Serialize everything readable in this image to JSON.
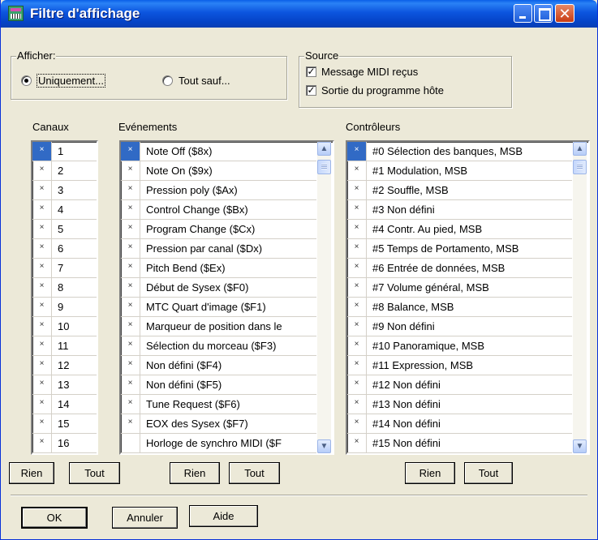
{
  "window": {
    "title": "Filtre d'affichage"
  },
  "afficher": {
    "label": "Afficher:",
    "options": [
      {
        "label": "Uniquement...",
        "checked": true
      },
      {
        "label": "Tout sauf...",
        "checked": false
      }
    ]
  },
  "source": {
    "label": "Source",
    "items": [
      {
        "label": "Message MIDI reçus",
        "checked": true
      },
      {
        "label": "Sortie du programme hôte",
        "checked": true
      }
    ]
  },
  "canaux": {
    "label": "Canaux",
    "rows": [
      {
        "mark": "×",
        "value": "1"
      },
      {
        "mark": "×",
        "value": "2"
      },
      {
        "mark": "×",
        "value": "3"
      },
      {
        "mark": "×",
        "value": "4"
      },
      {
        "mark": "×",
        "value": "5"
      },
      {
        "mark": "×",
        "value": "6"
      },
      {
        "mark": "×",
        "value": "7"
      },
      {
        "mark": "×",
        "value": "8"
      },
      {
        "mark": "×",
        "value": "9"
      },
      {
        "mark": "×",
        "value": "10"
      },
      {
        "mark": "×",
        "value": "11"
      },
      {
        "mark": "×",
        "value": "12"
      },
      {
        "mark": "×",
        "value": "13"
      },
      {
        "mark": "×",
        "value": "14"
      },
      {
        "mark": "×",
        "value": "15"
      },
      {
        "mark": "×",
        "value": "16"
      }
    ],
    "buttons": {
      "none": "Rien",
      "all": "Tout"
    }
  },
  "evenements": {
    "label": "Evénements",
    "rows": [
      {
        "mark": "×",
        "value": "Note Off ($8x)"
      },
      {
        "mark": "×",
        "value": "Note On ($9x)"
      },
      {
        "mark": "×",
        "value": "Pression poly ($Ax)"
      },
      {
        "mark": "×",
        "value": "Control Change ($Bx)"
      },
      {
        "mark": "×",
        "value": "Program Change ($Cx)"
      },
      {
        "mark": "×",
        "value": "Pression par canal ($Dx)"
      },
      {
        "mark": "×",
        "value": "Pitch Bend ($Ex)"
      },
      {
        "mark": "×",
        "value": "Début de Sysex ($F0)"
      },
      {
        "mark": "×",
        "value": "MTC Quart d'image ($F1)"
      },
      {
        "mark": "×",
        "value": "Marqueur de position dans le"
      },
      {
        "mark": "×",
        "value": "Sélection du morceau ($F3)"
      },
      {
        "mark": "×",
        "value": "Non défini ($F4)"
      },
      {
        "mark": "×",
        "value": "Non défini ($F5)"
      },
      {
        "mark": "×",
        "value": "Tune Request ($F6)"
      },
      {
        "mark": "×",
        "value": "EOX des Sysex ($F7)"
      },
      {
        "mark": "",
        "value": "Horloge de synchro MIDI ($F"
      }
    ],
    "buttons": {
      "none": "Rien",
      "all": "Tout"
    }
  },
  "controleurs": {
    "label": "Contrôleurs",
    "rows": [
      {
        "mark": "×",
        "value": "#0 Sélection des banques, MSB"
      },
      {
        "mark": "×",
        "value": "#1 Modulation, MSB"
      },
      {
        "mark": "×",
        "value": "#2 Souffle, MSB"
      },
      {
        "mark": "×",
        "value": "#3 Non défini"
      },
      {
        "mark": "×",
        "value": "#4 Contr. Au pied, MSB"
      },
      {
        "mark": "×",
        "value": "#5 Temps de Portamento, MSB"
      },
      {
        "mark": "×",
        "value": "#6 Entrée de données, MSB"
      },
      {
        "mark": "×",
        "value": "#7 Volume général, MSB"
      },
      {
        "mark": "×",
        "value": "#8 Balance, MSB"
      },
      {
        "mark": "×",
        "value": "#9 Non défini"
      },
      {
        "mark": "×",
        "value": "#10 Panoramique, MSB"
      },
      {
        "mark": "×",
        "value": "#11 Expression, MSB"
      },
      {
        "mark": "×",
        "value": "#12 Non défini"
      },
      {
        "mark": "×",
        "value": "#13 Non défini"
      },
      {
        "mark": "×",
        "value": "#14 Non défini"
      },
      {
        "mark": "×",
        "value": "#15 Non défini"
      }
    ],
    "buttons": {
      "none": "Rien",
      "all": "Tout"
    }
  },
  "footer": {
    "ok": "OK",
    "cancel": "Annuler",
    "help": "Aide"
  },
  "colors": {
    "titlebar": "#0a55e0",
    "selection": "#316ac5",
    "dialog_bg": "#ece9d8"
  }
}
